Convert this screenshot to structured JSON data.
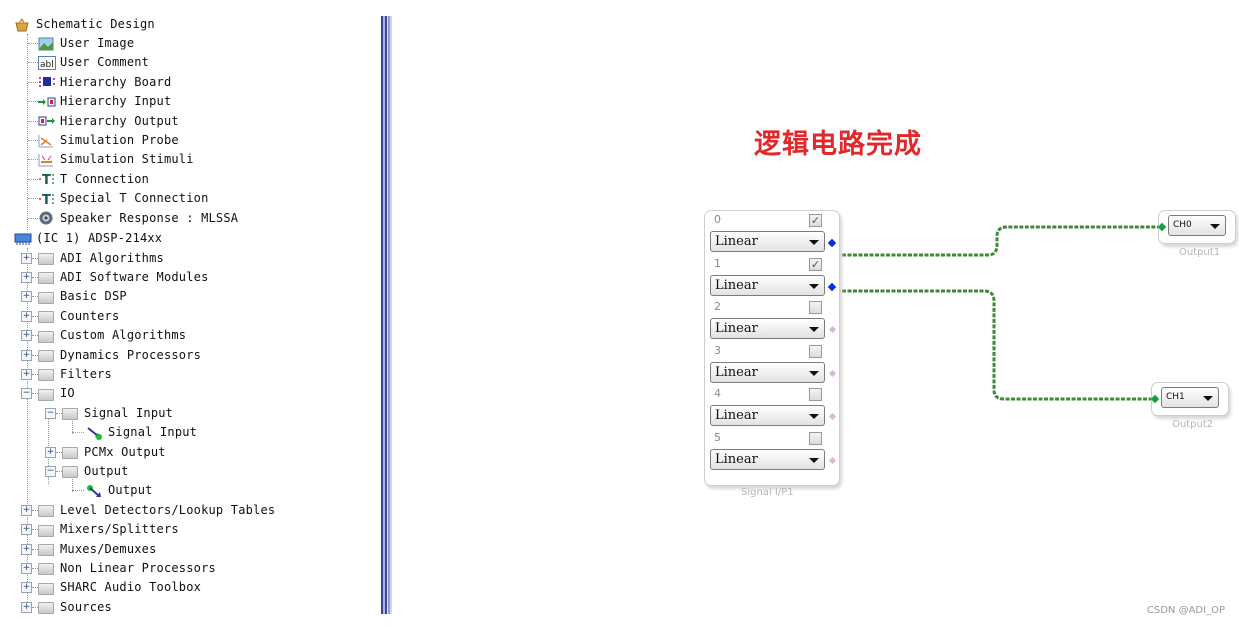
{
  "tree": {
    "root": {
      "label": "Schematic Design",
      "icon": "schematic-icon"
    },
    "schematic_items": [
      {
        "label": "User Image",
        "icon": "user-image-icon"
      },
      {
        "label": "User Comment",
        "icon": "user-comment-icon"
      },
      {
        "label": "Hierarchy Board",
        "icon": "hierarchy-board-icon"
      },
      {
        "label": "Hierarchy Input",
        "icon": "hierarchy-input-icon"
      },
      {
        "label": "Hierarchy Output",
        "icon": "hierarchy-output-icon"
      },
      {
        "label": "Simulation Probe",
        "icon": "simulation-probe-icon"
      },
      {
        "label": "Simulation Stimuli",
        "icon": "simulation-stimuli-icon"
      },
      {
        "label": "T Connection",
        "icon": "t-connection-icon"
      },
      {
        "label": "Special T Connection",
        "icon": "special-t-connection-icon"
      },
      {
        "label": "Speaker Response : MLSSA",
        "icon": "speaker-icon"
      }
    ],
    "ic": {
      "label": "(IC 1) ADSP-214xx",
      "icon": "chip-icon"
    },
    "folders_before_io": [
      "ADI Algorithms",
      "ADI Software Modules",
      "Basic DSP",
      "Counters",
      "Custom Algorithms",
      "Dynamics Processors",
      "Filters"
    ],
    "io": {
      "label": "IO",
      "signal_input_folder": "Signal Input",
      "signal_input_item": "Signal Input",
      "pcmx_output_folder": "PCMx Output",
      "output_folder": "Output",
      "output_item": "Output"
    },
    "folders_after_io": [
      "Level Detectors/Lookup Tables",
      "Mixers/Splitters",
      "Muxes/Demuxes",
      "Non Linear Processors",
      "SHARC Audio Toolbox",
      "Sources"
    ]
  },
  "canvas": {
    "annotation": "逻辑电路完成",
    "input_block": {
      "caption": "Signal I/P1",
      "rows": [
        {
          "index": "0",
          "checked": true,
          "mode": "Linear",
          "connected": true
        },
        {
          "index": "1",
          "checked": true,
          "mode": "Linear",
          "connected": true
        },
        {
          "index": "2",
          "checked": false,
          "mode": "Linear",
          "connected": false
        },
        {
          "index": "3",
          "checked": false,
          "mode": "Linear",
          "connected": false
        },
        {
          "index": "4",
          "checked": false,
          "mode": "Linear",
          "connected": false
        },
        {
          "index": "5",
          "checked": false,
          "mode": "Linear",
          "connected": false
        }
      ]
    },
    "outputs": [
      {
        "caption": "Output1",
        "channel": "CH0"
      },
      {
        "caption": "Output2",
        "channel": "CH1"
      }
    ],
    "colors": {
      "wire": "#3f8a3a",
      "pin_connected": "#0a2fe0",
      "pin_output": "#12a23c",
      "pin_unconnected": "#d9b6d6",
      "annotation": "#e3282b"
    }
  },
  "watermark": "CSDN @ADI_OP"
}
